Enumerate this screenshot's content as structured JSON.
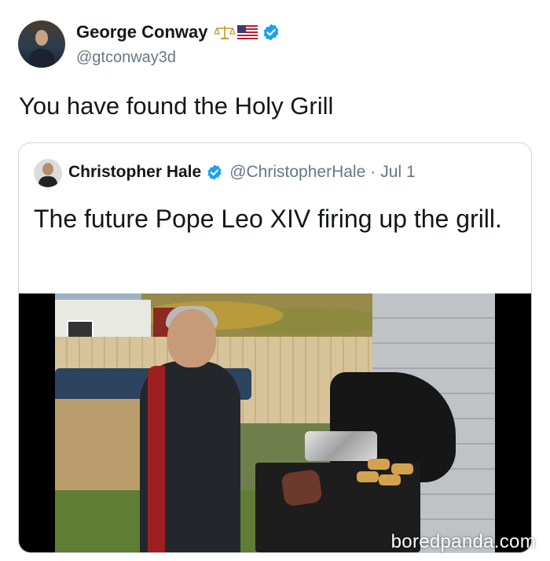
{
  "tweet": {
    "author_name": "George Conway",
    "author_handle": "@gtconway3d",
    "text": "You have found the Holy Grill",
    "badges": [
      "scales-icon",
      "us-flag-icon",
      "verified-icon"
    ],
    "verified_color": "#1DA1F2"
  },
  "quoted_tweet": {
    "author_name": "Christopher Hale",
    "author_handle": "@ChristopherHale",
    "separator": "·",
    "date": "Jul 1",
    "text": "The future Pope Leo XIV firing up the grill."
  },
  "watermark": "boredpanda.com"
}
